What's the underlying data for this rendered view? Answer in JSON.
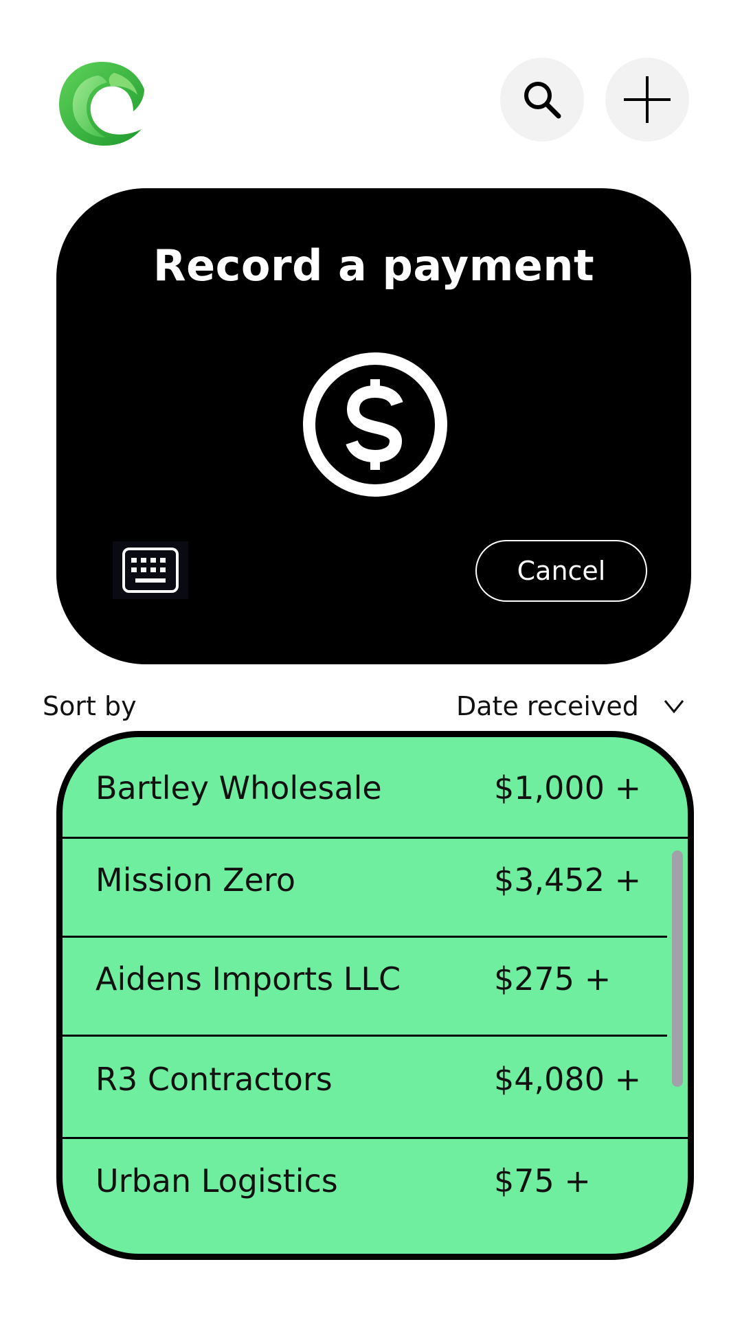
{
  "header": {
    "logo_icon": "wave-c-logo-icon",
    "search_icon": "search-icon",
    "add_icon": "plus-icon"
  },
  "payment_card": {
    "title": "Record a payment",
    "center_icon": "dollar-circle-icon",
    "keyboard_icon": "keyboard-icon",
    "cancel_label": "Cancel"
  },
  "sort": {
    "label": "Sort by",
    "selected": "Date received",
    "chevron_icon": "chevron-down-icon"
  },
  "payments": [
    {
      "name": "Bartley Wholesale",
      "amount": "$1,000 +"
    },
    {
      "name": "Mission Zero",
      "amount": "$3,452 +"
    },
    {
      "name": "Aidens Imports LLC",
      "amount": "$275 +"
    },
    {
      "name": "R3 Contractors",
      "amount": "$4,080 +"
    },
    {
      "name": "Urban Logistics",
      "amount": "$75 +"
    }
  ],
  "colors": {
    "list_background": "#6eee9e",
    "card_background": "#000000",
    "logo_green": "#3dbb3d"
  }
}
